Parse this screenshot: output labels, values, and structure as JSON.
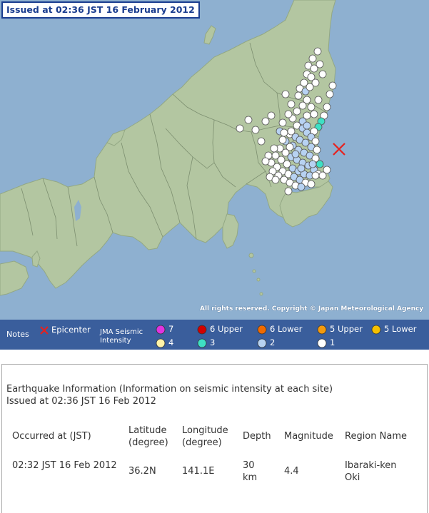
{
  "map": {
    "issued_banner": "Issued at 02:36 JST  16 February 2012",
    "copyright": "All rights reserved. Copyright © Japan Meteorological Agency",
    "colors": {
      "sea": "#8eb0d0",
      "land": "#b3c6a1",
      "boundary": "#7d8f70",
      "epicenter": "#e8201c"
    },
    "epicenter": {
      "latitude": 36.2,
      "longitude": 141.1
    }
  },
  "legend": {
    "notes_label": "Notes",
    "epicenter_label": "Epicenter",
    "intensity_label_line1": "JMA Seismic",
    "intensity_label_line2": "Intensity",
    "items": [
      {
        "label": "7",
        "color": "#e033e0"
      },
      {
        "label": "6 Upper",
        "color": "#d20000"
      },
      {
        "label": "6 Lower",
        "color": "#f06a00"
      },
      {
        "label": "5 Upper",
        "color": "#f39a0e"
      },
      {
        "label": "5 Lower",
        "color": "#f5c000"
      },
      {
        "label": "4",
        "color": "#fff3a8"
      },
      {
        "label": "3",
        "color": "#3ee0c4"
      },
      {
        "label": "2",
        "color": "#b7d2f2"
      },
      {
        "label": "1",
        "color": "#ffffff"
      }
    ]
  },
  "info": {
    "title": "Earthquake Information (Information on seismic intensity at each site)",
    "issued": "Issued at 02:36 JST 16 Feb 2012",
    "headers": [
      "Occurred at (JST)",
      "Latitude (degree)",
      "Longitude (degree)",
      "Depth",
      "Magnitude",
      "Region Name"
    ],
    "row": {
      "occurred": "02:32 JST 16 Feb 2012",
      "latitude": "36.2N",
      "longitude": "141.1E",
      "depth": "30 km",
      "magnitude": "4.4",
      "region": "Ibaraki-ken Oki"
    }
  }
}
